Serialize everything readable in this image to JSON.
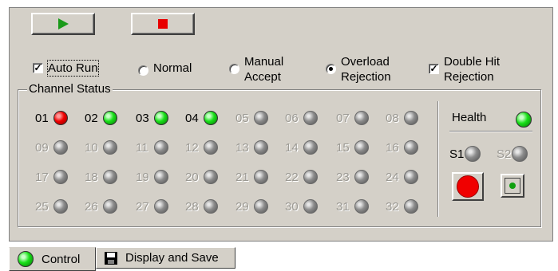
{
  "toolbar": {
    "play_icon": "play-icon",
    "stop_icon": "stop-icon",
    "play_color": "#1a9a1a",
    "stop_color": "#e80000"
  },
  "options": {
    "auto_run": {
      "label": "Auto Run",
      "checked": true
    },
    "normal": {
      "label": "Normal",
      "selected": false
    },
    "manual_accept": {
      "label": "Manual\nAccept",
      "selected": false
    },
    "overload_rejection": {
      "label": "Overload\nRejection",
      "selected": true
    },
    "double_hit_rejection": {
      "label": "Double Hit\nRejection",
      "checked": true
    },
    "check_mark": "✓"
  },
  "channel_status": {
    "title": "Channel Status",
    "channels": [
      {
        "label": "01",
        "state": "red"
      },
      {
        "label": "02",
        "state": "green"
      },
      {
        "label": "03",
        "state": "green"
      },
      {
        "label": "04",
        "state": "green"
      },
      {
        "label": "05",
        "state": "gray"
      },
      {
        "label": "06",
        "state": "gray"
      },
      {
        "label": "07",
        "state": "gray"
      },
      {
        "label": "08",
        "state": "gray"
      },
      {
        "label": "09",
        "state": "gray"
      },
      {
        "label": "10",
        "state": "gray"
      },
      {
        "label": "11",
        "state": "gray"
      },
      {
        "label": "12",
        "state": "gray"
      },
      {
        "label": "13",
        "state": "gray"
      },
      {
        "label": "14",
        "state": "gray"
      },
      {
        "label": "15",
        "state": "gray"
      },
      {
        "label": "16",
        "state": "gray"
      },
      {
        "label": "17",
        "state": "gray"
      },
      {
        "label": "18",
        "state": "gray"
      },
      {
        "label": "19",
        "state": "gray"
      },
      {
        "label": "20",
        "state": "gray"
      },
      {
        "label": "21",
        "state": "gray"
      },
      {
        "label": "22",
        "state": "gray"
      },
      {
        "label": "23",
        "state": "gray"
      },
      {
        "label": "24",
        "state": "gray"
      },
      {
        "label": "25",
        "state": "gray"
      },
      {
        "label": "26",
        "state": "gray"
      },
      {
        "label": "27",
        "state": "gray"
      },
      {
        "label": "28",
        "state": "gray"
      },
      {
        "label": "29",
        "state": "gray"
      },
      {
        "label": "30",
        "state": "gray"
      },
      {
        "label": "31",
        "state": "gray"
      },
      {
        "label": "32",
        "state": "gray"
      }
    ]
  },
  "health": {
    "label": "Health",
    "state": "green",
    "s1": {
      "label": "S1",
      "state": "gray"
    },
    "s2": {
      "label": "S2",
      "state": "gray",
      "disabled": true
    },
    "big_button_color": "#f00000",
    "small_button_color": "#10a010"
  },
  "tabs": [
    {
      "label": "Control",
      "icon": "green-led-icon",
      "active": true
    },
    {
      "label": "Display and Save",
      "icon": "floppy-disk-icon",
      "active": false
    }
  ]
}
